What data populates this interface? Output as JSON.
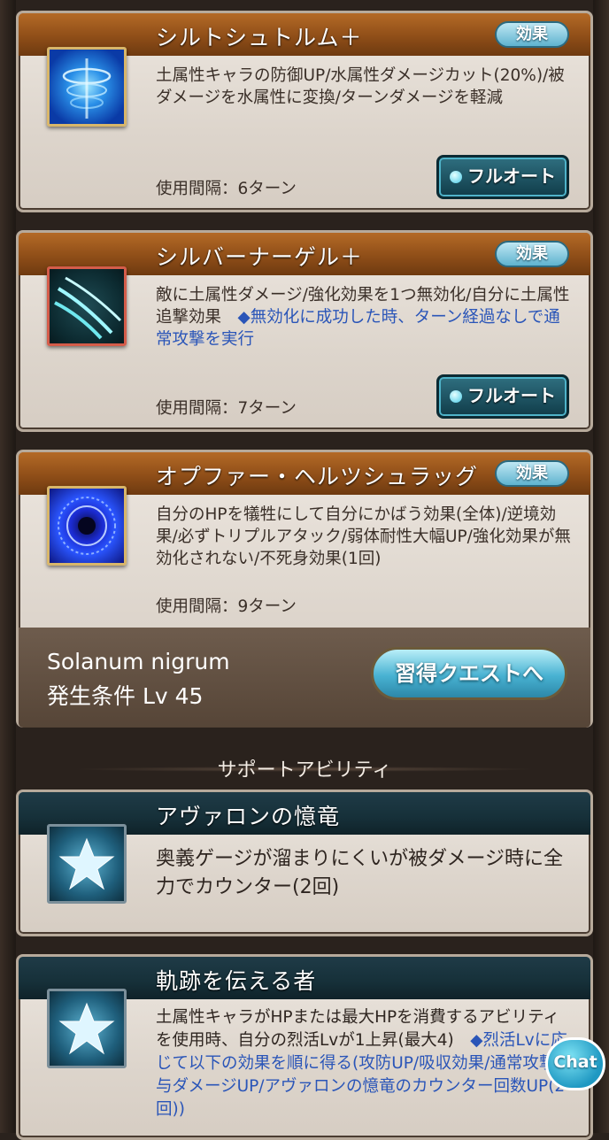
{
  "skills": [
    {
      "name": "シルトシュトルム＋",
      "badge": "効果",
      "description": "土属性キャラの防御UP/水属性ダメージカット(20%)/被ダメージを水属性に変換/ターンダメージを軽減",
      "description_note": "",
      "interval": "使用間隔：6ターン",
      "button": "フルオート",
      "icon": "water-vortex-icon",
      "accent": "#1e7fe0"
    },
    {
      "name": "シルバーナーゲル＋",
      "badge": "効果",
      "description": "敵に土属性ダメージ/強化効果を1つ無効化/自分に土属性追撃効果　",
      "description_note": "◆無効化に成功した時、ターン経過なしで通常攻撃を実行",
      "interval": "使用間隔：7ターン",
      "button": "フルオート",
      "icon": "claw-slash-icon",
      "accent": "#3ad2c4"
    },
    {
      "name": "オプファー・ヘルツシュラッグ",
      "badge": "効果",
      "description": "自分のHPを犠牲にして自分にかばう効果(全体)/逆境効果/必ずトリプルアタック/弱体耐性大幅UP/強化効果が無効化されない/不死身効果(1回)",
      "description_note": "",
      "interval": "使用間隔：9ターン",
      "button": "",
      "icon": "blue-rune-circle-icon",
      "accent": "#2a3ce0"
    }
  ],
  "quest": {
    "name": "Solanum nigrum",
    "condition": "発生条件 Lv 45",
    "button": "習得クエストへ"
  },
  "support": {
    "section_title": "サポートアビリティ",
    "items": [
      {
        "name": "アヴァロンの憶竜",
        "description": "奥義ゲージが溜まりにくいが被ダメージ時に全力でカウンター(2回)",
        "note": ""
      },
      {
        "name": "軌跡を伝える者",
        "description": "土属性キャラがHPまたは最大HPを消費するアビリティを使用時、自分の烈活Lvが1上昇(最大4)　",
        "note": "◆烈活Lvに応じて以下の効果を順に得る(攻防UP/吸収効果/通常攻撃の与ダメージUP/アヴァロンの憶竜のカウンター回数UP(2回))"
      }
    ]
  },
  "chat_label": "Chat"
}
